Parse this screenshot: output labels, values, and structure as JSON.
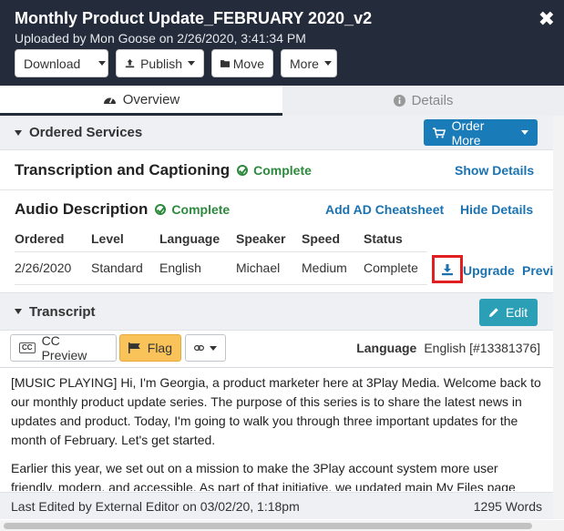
{
  "header": {
    "title": "Monthly Product Update_FEBRUARY 2020_v2",
    "subtitle": "Uploaded by Mon Goose on 2/26/2020, 3:41:34 PM",
    "close_label": "✖",
    "buttons": {
      "download": "Download",
      "publish": "Publish",
      "move": "Move",
      "more": "More"
    }
  },
  "tabs": {
    "overview": "Overview",
    "details": "Details"
  },
  "ordered_services": {
    "title": "Ordered Services",
    "order_more_label": "Order More",
    "transcription": {
      "name": "Transcription and Captioning",
      "status": "Complete",
      "action": "Show Details"
    },
    "audio_description": {
      "name": "Audio Description",
      "status": "Complete",
      "cheatsheet_link": "Add AD Cheatsheet",
      "details_link": "Hide Details",
      "columns": [
        "Ordered",
        "Level",
        "Language",
        "Speaker",
        "Speed",
        "Status"
      ],
      "row": {
        "ordered": "2/26/2020",
        "level": "Standard",
        "language": "English",
        "speaker": "Michael",
        "speed": "Medium",
        "status": "Complete",
        "upgrade": "Upgrade",
        "preview": "Previ"
      }
    }
  },
  "transcript": {
    "title": "Transcript",
    "edit_label": "Edit",
    "cc_preview_label": "CC Preview",
    "flag_label": "Flag",
    "language_label": "Language",
    "language_value": "English [#13381376]",
    "paragraphs": [
      "[MUSIC PLAYING] Hi, I'm Georgia, a product marketer here at 3Play Media. Welcome back to our monthly product update series. The purpose of this series is to share the latest news in updates and product. Today, I'm going to walk you through three important updates for the month of February. Let's get started.",
      "Earlier this year, we set out on a mission to make the 3Play account system more user friendly, modern, and accessible. As part of that initiative, we updated main My Files page"
    ],
    "footer_left": "Last Edited by External Editor on 03/02/20, 1:18pm",
    "footer_right": "1295 Words"
  }
}
